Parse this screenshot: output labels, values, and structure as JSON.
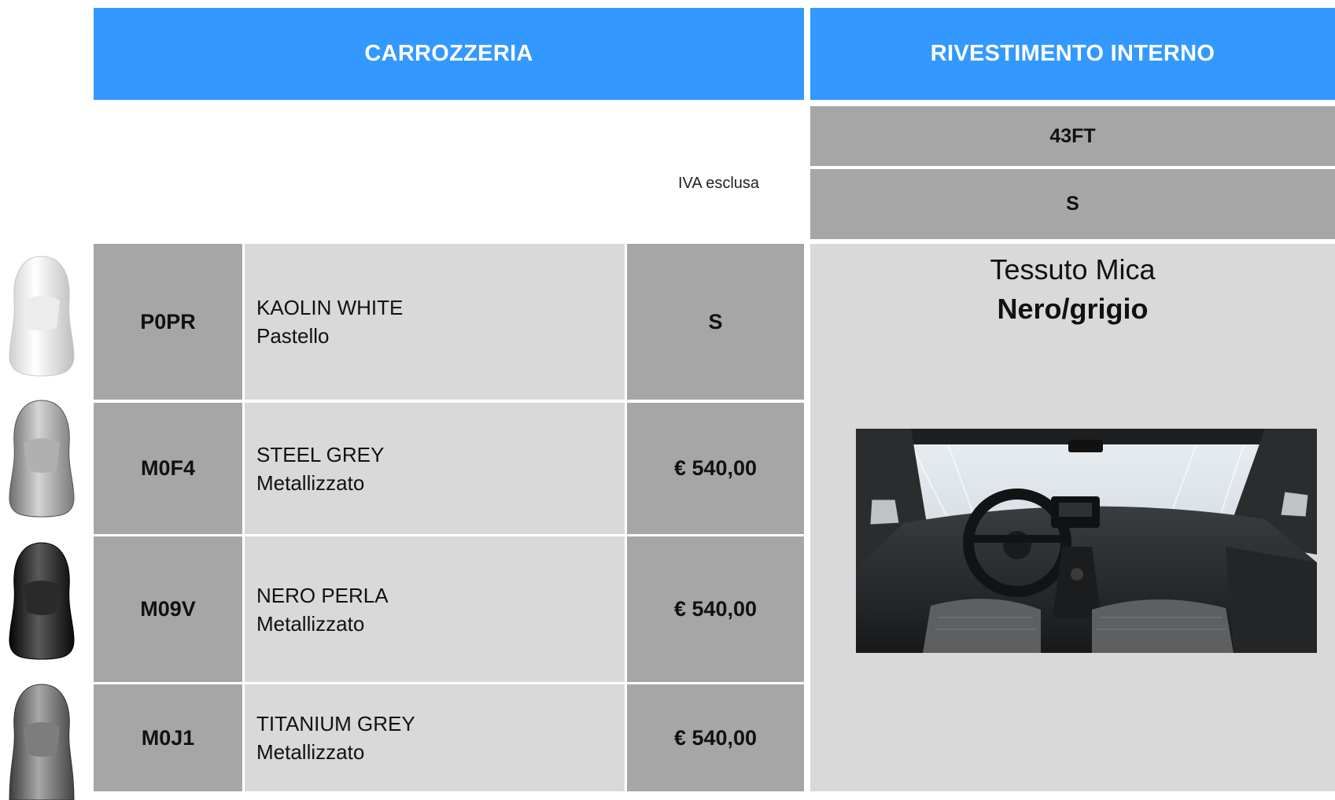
{
  "headers": {
    "body": "CARROZZERIA",
    "interior": "RIVESTIMENTO INTERNO"
  },
  "vat_note": "IVA esclusa",
  "trim": {
    "code": "43FT",
    "level": "S"
  },
  "colors": [
    {
      "code": "P0PR",
      "name": "KAOLIN WHITE",
      "finish": "Pastello",
      "price": "S",
      "swatch": "white"
    },
    {
      "code": "M0F4",
      "name": "STEEL GREY",
      "finish": "Metallizzato",
      "price": "€ 540,00",
      "swatch": "silver"
    },
    {
      "code": "M09V",
      "name": "NERO PERLA",
      "finish": "Metallizzato",
      "price": "€ 540,00",
      "swatch": "black"
    },
    {
      "code": "M0J1",
      "name": "TITANIUM GREY",
      "finish": "Metallizzato",
      "price": "€ 540,00",
      "swatch": "dark-grey"
    }
  ],
  "interior": {
    "fabric": "Tessuto Mica",
    "color": "Nero/grigio"
  },
  "palette": {
    "header_blue": "#3399ff",
    "dark_cell": "#a6a6a6",
    "light_cell": "#d9d9d9"
  }
}
